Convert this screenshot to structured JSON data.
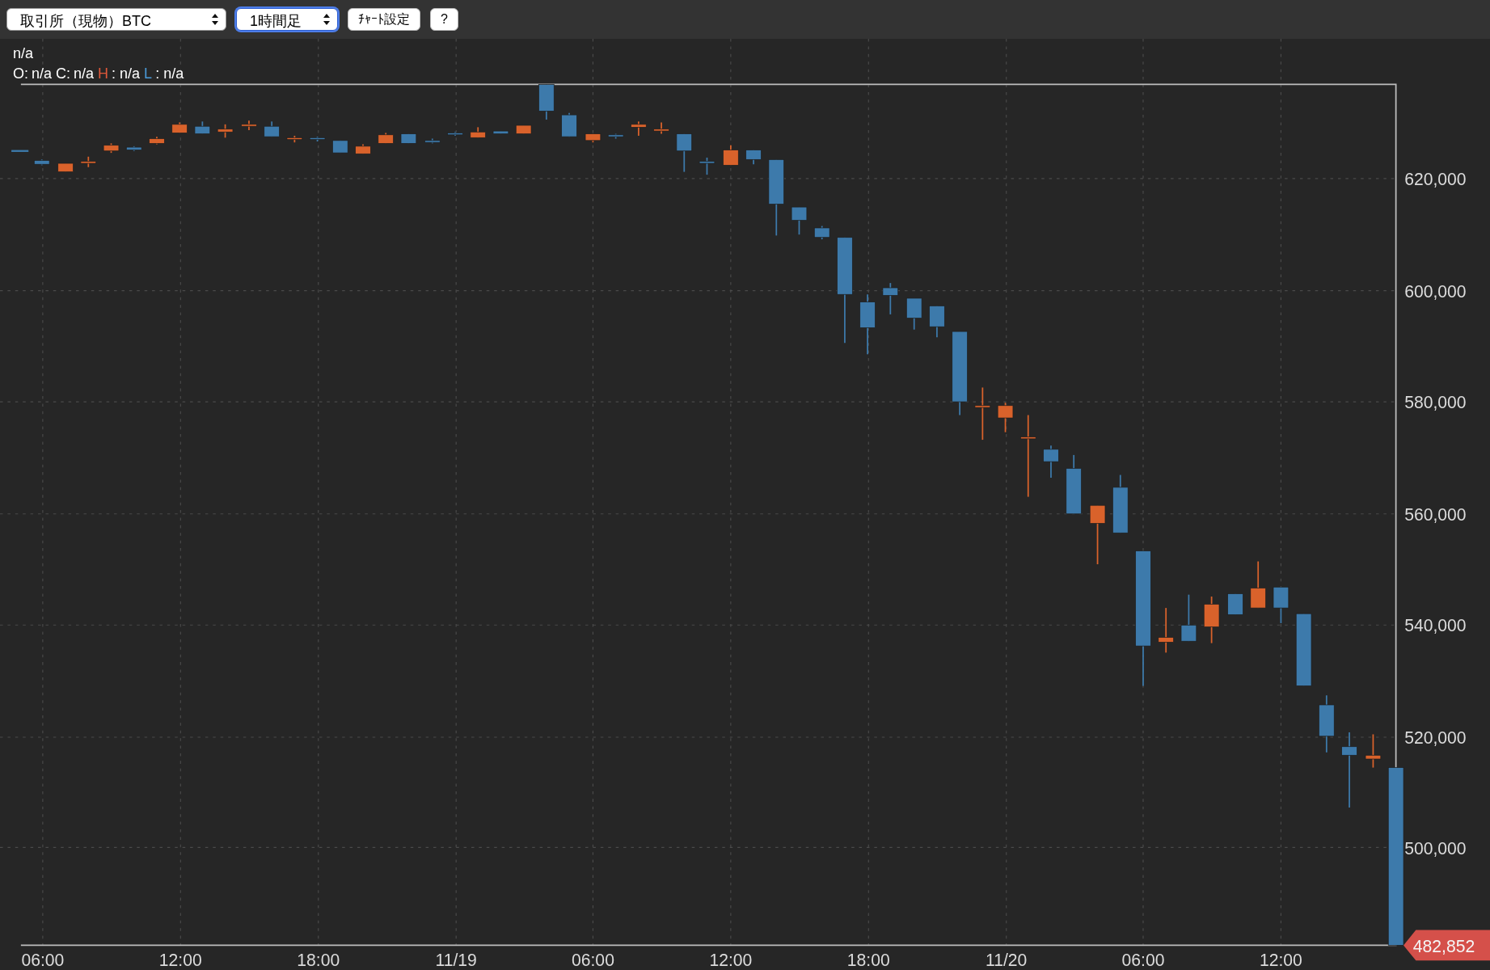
{
  "toolbar": {
    "market_select": {
      "value": "取引所（現物）BTC",
      "focused": false
    },
    "interval_select": {
      "value": "1時間足",
      "focused": true
    },
    "buttons": [
      "ﾁｬｰﾄ設定",
      "?"
    ]
  },
  "legend": {
    "title": "n/a",
    "items": [
      {
        "label": "O:",
        "value": "n/a",
        "color": "#ffffff"
      },
      {
        "label": "C:",
        "value": "n/a",
        "color": "#ffffff"
      },
      {
        "label": "H",
        "value": ": n/a",
        "color": "#e0583a"
      },
      {
        "label": "L",
        "value": ": n/a",
        "color": "#4a9ad8"
      }
    ]
  },
  "chart": {
    "y_labels": [
      "620,000",
      "600,000",
      "580,000",
      "560,000",
      "540,000",
      "520,000",
      "500,000"
    ],
    "x_labels": [
      "06:00",
      "12:00",
      "18:00",
      "11/19",
      "06:00",
      "12:00",
      "18:00",
      "11/20",
      "06:00",
      "12:00"
    ],
    "last_price": "482,852"
  }
}
